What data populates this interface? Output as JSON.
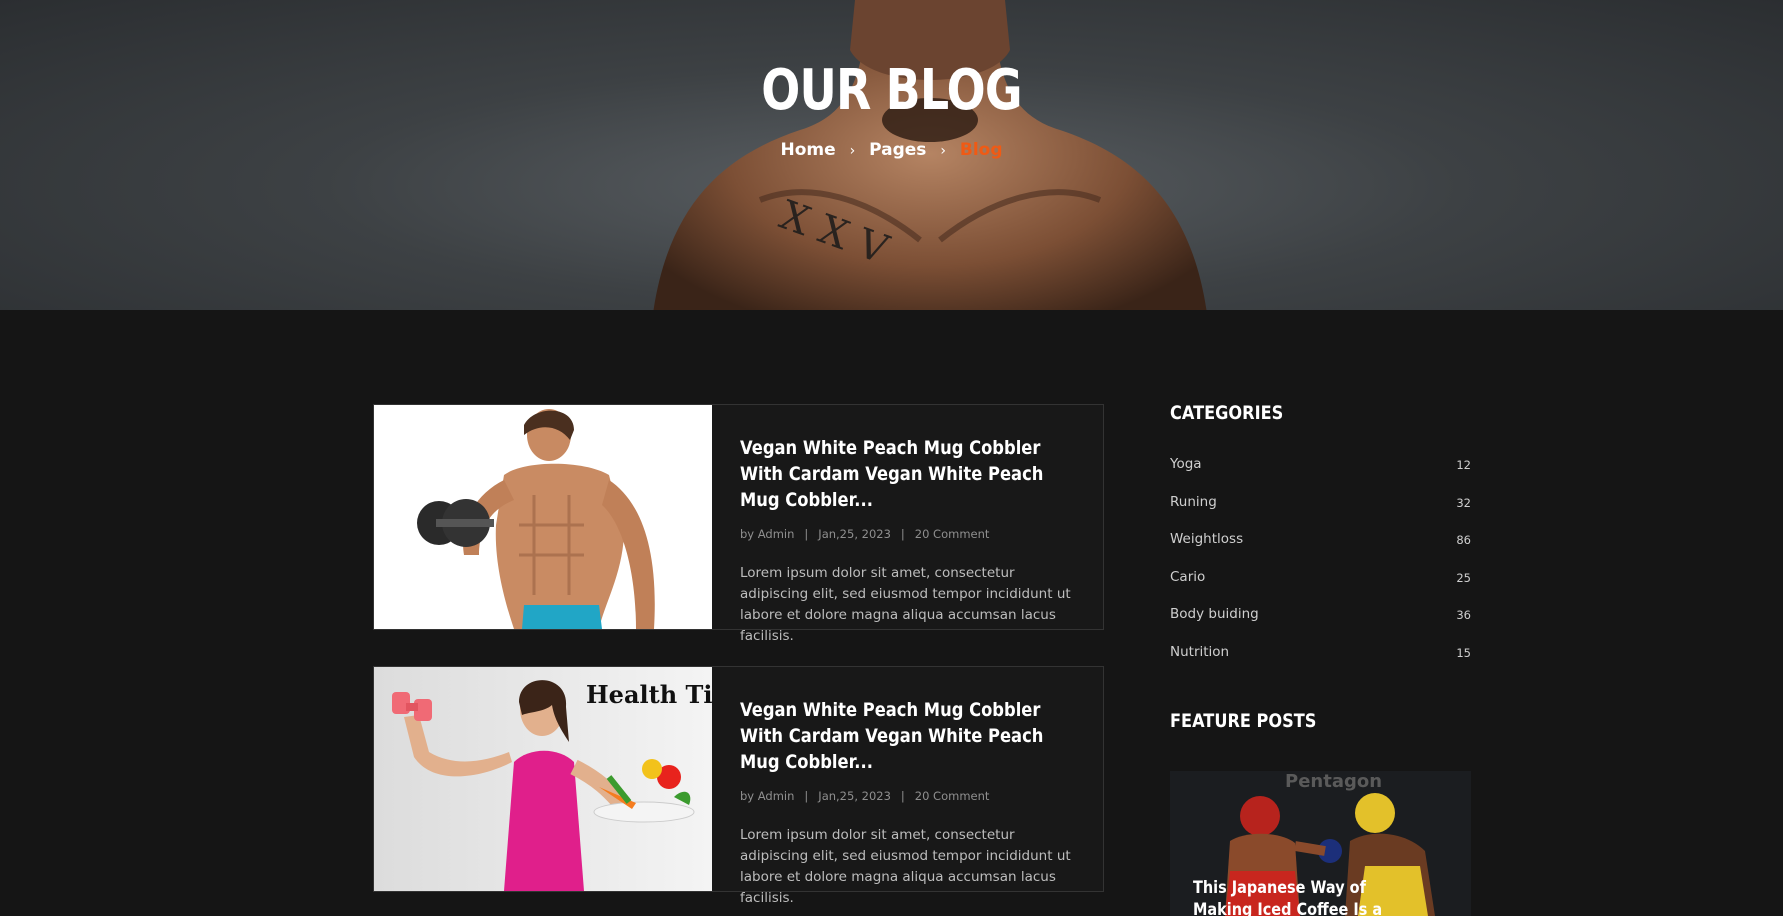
{
  "hero": {
    "title": "OUR BLOG",
    "breadcrumb": {
      "home": "Home",
      "pages": "Pages",
      "current": "Blog",
      "separator": "›"
    }
  },
  "posts": [
    {
      "title": "Vegan White Peach Mug Cobbler With Cardam Vegan White Peach Mug Cobbler...",
      "author": "by Admin",
      "date": "Jan,25, 2023",
      "comments": "20 Comment",
      "excerpt": "Lorem ipsum dolor sit amet, consectetur adipiscing elit, sed eiusmod tempor incididunt ut labore et dolore magna aliqua accumsan lacus facilisis.",
      "image": "man-dumbbell-curl-image"
    },
    {
      "title": "Vegan White Peach Mug Cobbler With Cardam Vegan White Peach Mug Cobbler...",
      "author": "by Admin",
      "date": "Jan,25, 2023",
      "comments": "20 Comment",
      "excerpt": "Lorem ipsum dolor sit amet, consectetur adipiscing elit, sed eiusmod tempor incididunt ut labore et dolore magna aliqua accumsan lacus facilisis.",
      "image": "health-tips-woman-image",
      "image_caption": "Health Tips"
    }
  ],
  "sidebar": {
    "categories_heading": "CATEGORIES",
    "categories": [
      {
        "name": "Yoga",
        "count": "12"
      },
      {
        "name": "Runing",
        "count": "32"
      },
      {
        "name": "Weightloss",
        "count": "86"
      },
      {
        "name": "Cario",
        "count": "25"
      },
      {
        "name": "Body buiding",
        "count": "36"
      },
      {
        "name": "Nutrition",
        "count": "15"
      }
    ],
    "feature_heading": "FEATURE POSTS",
    "feature_post": {
      "title": "This Japanese Way of Making Iced Coffee Is a Game...",
      "image": "boxing-match-image",
      "image_watermark": "Pentagon"
    }
  },
  "colors": {
    "accent": "#f05a14",
    "background": "#151515",
    "text": "#ffffff"
  }
}
